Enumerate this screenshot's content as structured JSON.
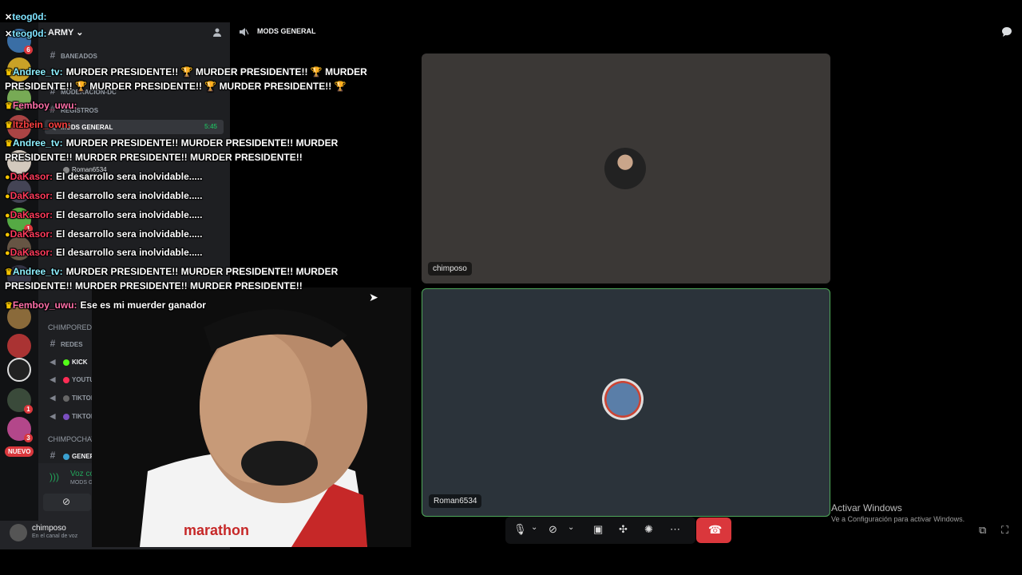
{
  "server": {
    "name": "ARMY",
    "categories": {
      "redes": "CHIMPOREDES",
      "chat": "CHIMPOCHAT"
    },
    "channels_top": [
      {
        "label": "BANEADOS"
      },
      {
        "label": "MODERACIÓN-DC"
      },
      {
        "label": "REGISTROS"
      }
    ],
    "active_channel": {
      "label": "MODS GENERAL",
      "time": "5:45"
    },
    "voice_member": "Roman6534",
    "channels_redes": [
      {
        "label": "REDES",
        "type": "text"
      },
      {
        "label": "KICK",
        "type": "voice",
        "color": "#53fc18"
      },
      {
        "label": "YOUTUBE",
        "type": "voice",
        "color": "#ff2d55"
      },
      {
        "label": "TIKTOK",
        "type": "voice",
        "color": "#666666"
      },
      {
        "label": "TIKTOK-LIVES",
        "type": "voice",
        "color": "#7a4fbf"
      }
    ],
    "channels_chat": [
      {
        "label": "GENERAL",
        "type": "text"
      }
    ],
    "nuevo_badge": "NUEVO"
  },
  "voice": {
    "status": "Voz conectada",
    "sub": "MODS GENERAL / ChimpoAR"
  },
  "user": {
    "name": "chimposo",
    "status": "En el canal de voz"
  },
  "topbar": {
    "title": "MODS GENERAL"
  },
  "tiles": [
    {
      "label": "chimposo"
    },
    {
      "label": "Roman6534"
    }
  ],
  "activate_windows": {
    "title": "Activar Windows",
    "sub": "Ve a Configuración para activar Windows."
  },
  "chat_messages": [
    {
      "nick": "teog0d:",
      "color": "#7fe3ff",
      "text": ""
    },
    {
      "nick": "teog0d:",
      "color": "#7fe3ff",
      "text": ""
    },
    {
      "nick": "Andree_tv:",
      "color": "#8ef0ff",
      "text": "MURDER PRESIDENTE!! 🏆 MURDER PRESIDENTE!! 🏆 MURDER"
    },
    {
      "nick": "",
      "color": "#ffffff",
      "text": "PRESIDENTE!! 🏆 MURDER PRESIDENTE!! 🏆 MURDER PRESIDENTE!! 🏆"
    },
    {
      "nick": "Femboy_uwu:",
      "color": "#ff6fa8",
      "text": ""
    },
    {
      "nick": "Itzbein_own:",
      "color": "#ff4040",
      "text": ""
    },
    {
      "nick": "Andree_tv:",
      "color": "#8ef0ff",
      "text": "MURDER PRESIDENTE!! MURDER PRESIDENTE!! MURDER"
    },
    {
      "nick": "",
      "color": "#ffffff",
      "text": "PRESIDENTE!! MURDER PRESIDENTE!! MURDER PRESIDENTE!!"
    },
    {
      "nick": "DaKasor:",
      "color": "#ff3b5c",
      "text": "El desarrollo sera inolvidable....."
    },
    {
      "nick": "DaKasor:",
      "color": "#ff3b5c",
      "text": "El desarrollo sera inolvidable....."
    },
    {
      "nick": "DaKasor:",
      "color": "#ff3b5c",
      "text": "El desarrollo sera inolvidable....."
    },
    {
      "nick": "DaKasor:",
      "color": "#ff3b5c",
      "text": "El desarrollo sera inolvidable....."
    },
    {
      "nick": "DaKasor:",
      "color": "#ff3b5c",
      "text": "El desarrollo sera inolvidable....."
    },
    {
      "nick": "Andree_tv:",
      "color": "#8ef0ff",
      "text": "MURDER PRESIDENTE!! MURDER PRESIDENTE!! MURDER"
    },
    {
      "nick": "",
      "color": "#ffffff",
      "text": "PRESIDENTE!! MURDER PRESIDENTE!! MURDER PRESIDENTE!!"
    },
    {
      "nick": "Femboy_uwu:",
      "color": "#ff6fa8",
      "text": "Ese es mi muerder ganador"
    }
  ],
  "colors": {
    "accent_green": "#23a55a",
    "danger": "#da373c",
    "speaking": "#4fa85a"
  }
}
